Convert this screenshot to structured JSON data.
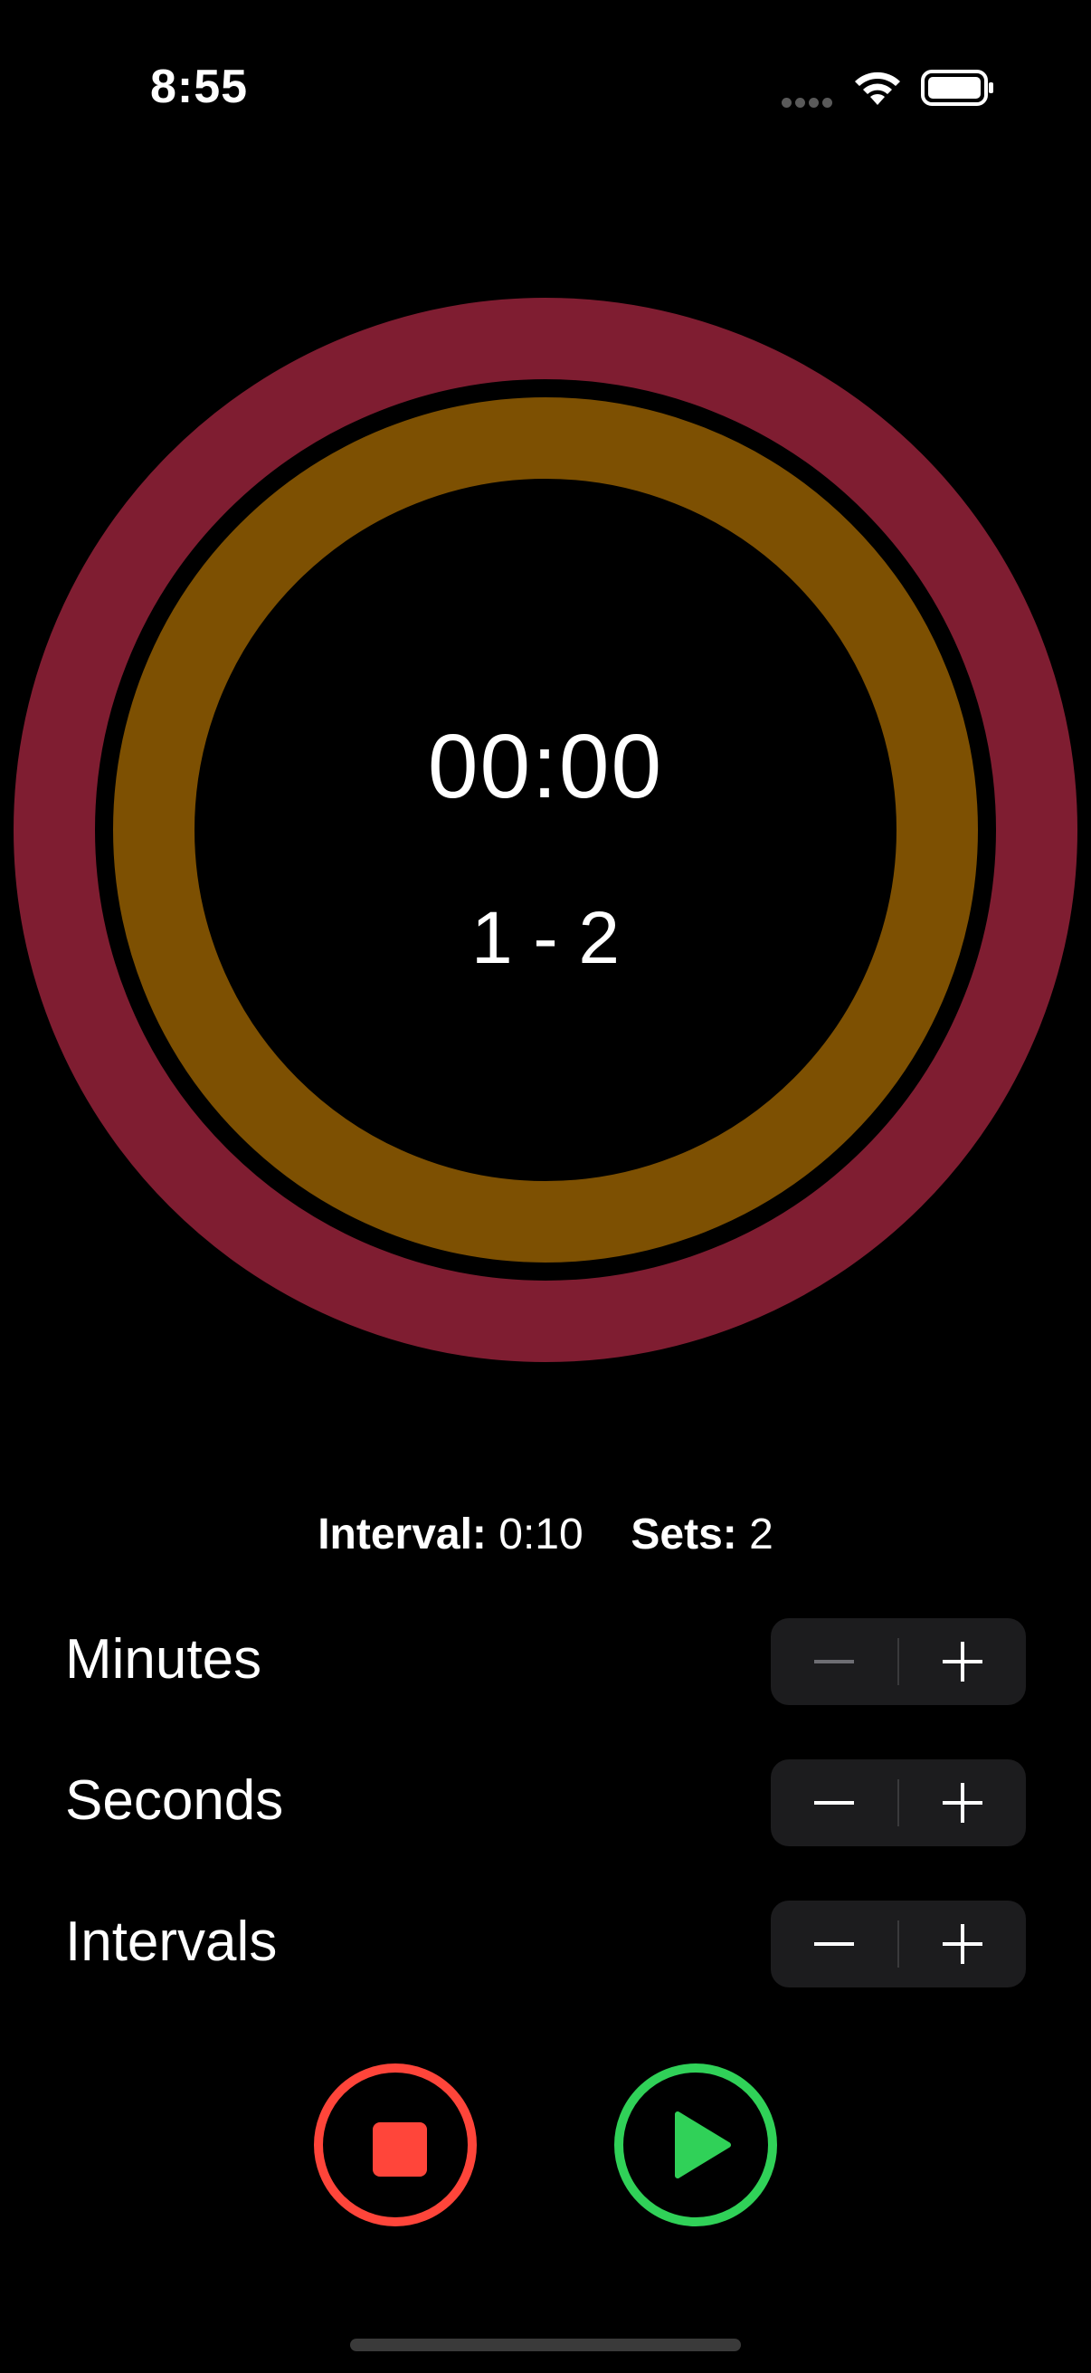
{
  "status_bar": {
    "time": "8:55"
  },
  "timer": {
    "time_display": "00:00",
    "set_display": "1 - 2",
    "outer_ring_color": "#7f1d31",
    "inner_ring_color": "#7d5002"
  },
  "info": {
    "interval_label": "Interval:",
    "interval_value": "0:10",
    "sets_label": "Sets:",
    "sets_value": "2"
  },
  "settings": {
    "minutes_label": "Minutes",
    "seconds_label": "Seconds",
    "intervals_label": "Intervals"
  },
  "controls": {
    "stop_color": "#ff453a",
    "play_color": "#30d158",
    "stop_icon": "stop-square-icon",
    "play_icon": "play-triangle-icon"
  }
}
